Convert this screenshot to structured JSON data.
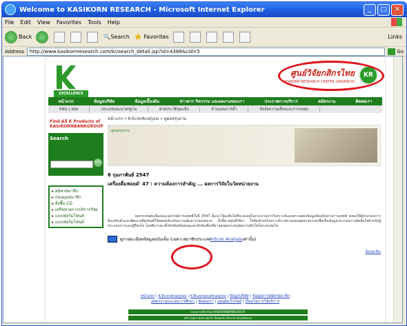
{
  "window": {
    "title": "Welcome to KASIKORN RESEARCH - Microsoft Internet Explorer"
  },
  "menu": [
    "File",
    "Edit",
    "View",
    "Favorites",
    "Tools",
    "Help"
  ],
  "toolbar": {
    "back": "Back",
    "search": "Search",
    "favorites": "Favorites",
    "links": "Links"
  },
  "address": {
    "label": "Address",
    "url": "http://www.kasikornresearch.com/kr/search_detail.jsp?id=4388&cid=5",
    "go": "Go"
  },
  "brand": {
    "name": "ศูนย์วิจัยกสิกรไทย",
    "sub": "KASIKORN RESEARCH CENTER (KRSERCH)",
    "kr": "KR",
    "excellence": "EXCELLENCE"
  },
  "nav1": [
    "หน้าแรก",
    "ข้อมูลบริษัท",
    "ข้อมูลเบื้องต้น",
    "ข่าวสาร กิจกรรม และผลงานของเรา",
    "ประกาศการบริการ",
    "สมัครงาน",
    "ติดต่อเรา"
  ],
  "nav2": [
    "ENG | ซอย",
    "ประเภทและมาตรฐาน",
    "ฝ่ายประวัติจุดแข็ง",
    "ด้านแผนการค้ำ",
    "ปัจจัยความเสี่ยงและการลงทุน"
  ],
  "sidebar": {
    "find": "Find All K Products of KASIKORNBANKGROUP",
    "search_label": "Search",
    "go": "GO",
    "links": [
      "สมัครสมาชิก",
      "ก่อนมุมสมาชิก",
      "สิ่งซื้อ CD",
      "เครือข่ายการบริการวิจัย",
      "แบบฟอร์มโฟนต์",
      "แบบฟอร์มโฟนต์"
    ]
  },
  "content": {
    "crumb": "หน้าแรก » K-EconAnalysis » ดูผลสรุปงาน",
    "banner_label": "ดูผลสรุปงาน",
    "date": "6 กุมภาพันธ์ 2547",
    "headline": "เครื่องดื่มฟอยด์' 47 : ความต้องการสำคัญ ... ผลการวิจัยในวัดหน่วยงาน",
    "paragraph": "ผลกระทบต่อเนื่องและอุปกรณ์การแพทย์ในปี 2547 มีแนวโน้มเติบโตที่จะคงอยู่ในกระบวนการวิเคราะห์และตรวจสอบข้อมูลปัจจุบันทางการแพทย์ ส่งผลให้ผู้ประกอบการต้องปรับตัวและพัฒนาผลิตภัณฑ์ให้สอดคล้องกับความต้องการของตลาด ทั้งนี้ทางศูนย์วิจัยฯ ได้จัดทำบทวิเคราะห์ภาพรวมของอุตสาหกรรมเพื่อเป็นข้อมูลประกอบการตัดสินใจสำหรับผู้ประกอบการและผู้ที่สนใจ โดยพิจารณาทั้งปัจจัยสนับสนุนและปัจจัยเสี่ยงที่อาจส่งผลกระทบต่อการเติบโตในระยะต่อไป",
    "download_text": "ดูรายละเอียดข้อมูลฉบับเต็ม (เฉพาะสมาชิกประเภท ",
    "download_link": "K-Econ Analysis",
    "download_suffix": " เท่านั้น)",
    "back": "ย้อนกลับ"
  },
  "footer": {
    "row1": [
      "หน้าแรก",
      "K-EconAnalysis",
      "K-BusinessAnalysis",
      "ข้อมูลบริษัท",
      "ข้อมูลการสมัครสมาชิก"
    ],
    "row2": [
      "สมัครงานและทุนการศึกษา",
      "ติดต่อเรา",
      "แผนผังเว็บไซต์",
      "เงื่อนไขการใช้บริการ"
    ],
    "bar1": "ธนาคารกสิกรไทย KASIKORNBANKGROUP",
    "bar2": "บริการทุกระดับประทับใจ Towards Service Excellence"
  }
}
